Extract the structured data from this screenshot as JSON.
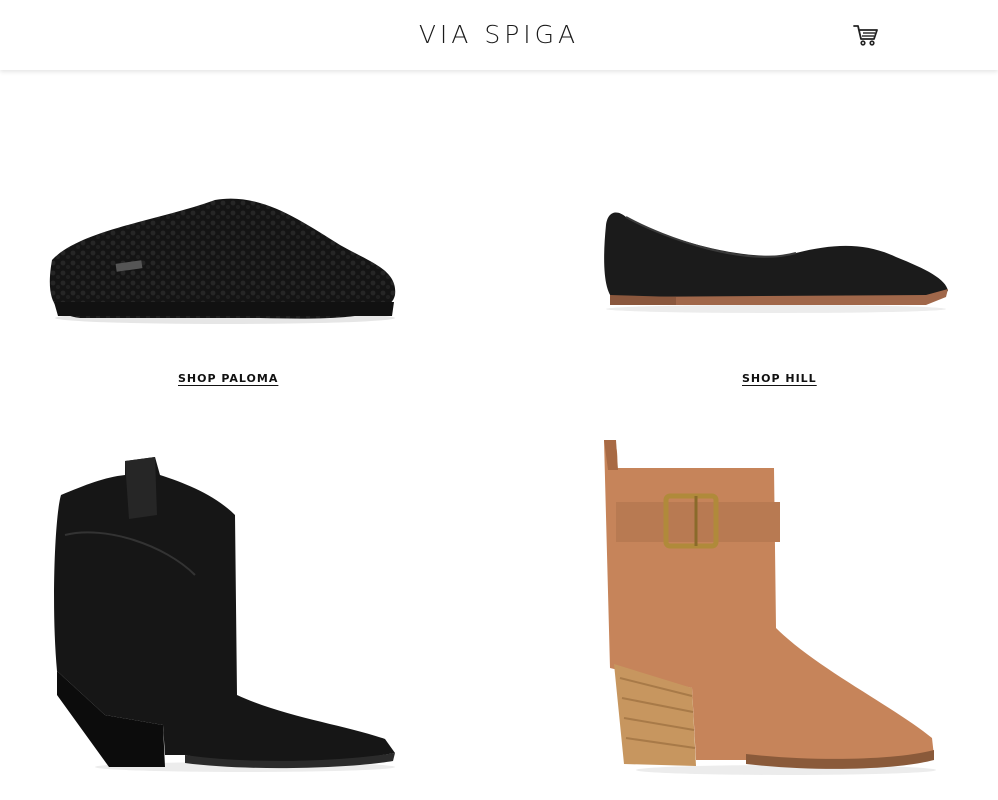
{
  "header": {
    "brand": "VIA SPIGA",
    "cart_icon": "shopping-cart-icon"
  },
  "products": [
    {
      "link_label": "SHOP PALOMA",
      "icon": "slipper-image"
    },
    {
      "link_label": "SHOP HILL",
      "icon": "flat-shoe-image"
    },
    {
      "link_label": "",
      "icon": "western-boot-image"
    },
    {
      "link_label": "",
      "icon": "buckle-bootie-image"
    }
  ]
}
